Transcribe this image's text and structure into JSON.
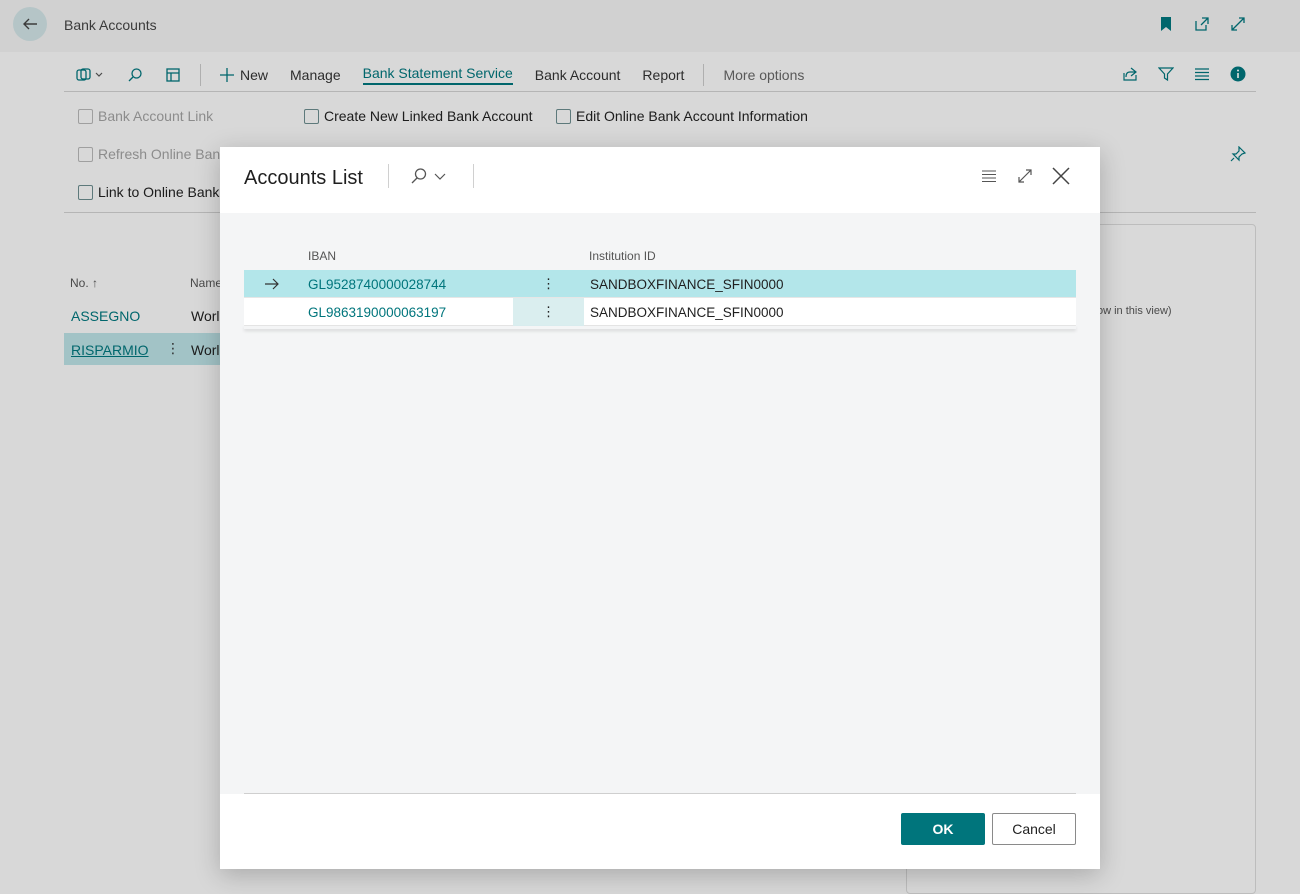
{
  "page": {
    "title": "Bank Accounts"
  },
  "actionbar": {
    "new_label": "New",
    "manage_label": "Manage",
    "bank_statement_service_label": "Bank Statement Service",
    "bank_account_label": "Bank Account",
    "report_label": "Report",
    "more_options_label": "More options"
  },
  "subactions": {
    "bank_account_link": "Bank Account Link",
    "create_new_linked": "Create New Linked Bank Account",
    "edit_online_info": "Edit Online Bank Account Information",
    "refresh_online_bank": "Refresh Online Bank",
    "link_to_online_bank": "Link to Online Bank"
  },
  "bank_list": {
    "col_no": "No. ↑",
    "col_name": "Name",
    "rows": [
      {
        "no": "ASSEGNO",
        "name": "Worl"
      },
      {
        "no": "RISPARMIO",
        "name": "Worl"
      }
    ]
  },
  "factbox": {
    "partial_text": "ow in this view)"
  },
  "dialog": {
    "title": "Accounts List",
    "columns": {
      "iban": "IBAN",
      "institution_id": "Institution ID"
    },
    "rows": [
      {
        "iban": "GL9528740000028744",
        "institution_id": "SANDBOXFINANCE_SFIN0000",
        "selected": true
      },
      {
        "iban": "GL9863190000063197",
        "institution_id": "SANDBOXFINANCE_SFIN0000",
        "selected": false
      }
    ],
    "ok_label": "OK",
    "cancel_label": "Cancel"
  },
  "colors": {
    "accent": "#00757c",
    "selected_row": "#b3e6ea"
  }
}
